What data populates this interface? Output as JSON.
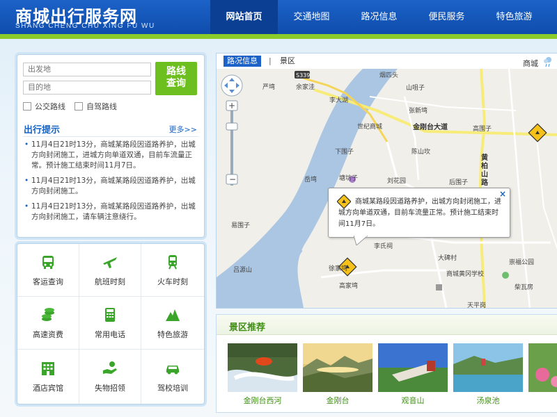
{
  "header": {
    "title": "商城出行服务网",
    "subtitle": "SHANG CHENG CHU XING FU WU",
    "nav": [
      "网站首页",
      "交通地图",
      "路况信息",
      "便民服务",
      "特色旅游"
    ],
    "active_nav": 0
  },
  "route": {
    "from_placeholder": "出发地",
    "to_placeholder": "目的地",
    "query_line1": "路线",
    "query_line2": "查询",
    "bus_label": "公交路线",
    "drive_label": "自驾路线"
  },
  "tips": {
    "title": "出行提示",
    "more": "更多>>",
    "items": [
      "11月4日21时13分，商城某路段因道路养护，出城方向封闭施工，进城方向单道双通，目前车流量正常。预计施工结束时间11月7日。",
      "11月4日21时13分，商城某路段因道路养护，出城方向封闭施工。",
      "11月4日21时13分，商城某路段因道路养护，出城方向封闭施工，请车辆注意绕行。"
    ]
  },
  "services": [
    {
      "label": "客运查询",
      "icon": "bus-icon"
    },
    {
      "label": "航班时刻",
      "icon": "airplane-icon"
    },
    {
      "label": "火车时刻",
      "icon": "train-icon"
    },
    {
      "label": "高速资费",
      "icon": "coins-icon"
    },
    {
      "label": "常用电话",
      "icon": "phone-icon"
    },
    {
      "label": "特色旅游",
      "icon": "mountain-icon"
    },
    {
      "label": "酒店宾馆",
      "icon": "hotel-icon"
    },
    {
      "label": "失物招领",
      "icon": "hand-icon"
    },
    {
      "label": "驾校培训",
      "icon": "car-icon"
    }
  ],
  "map": {
    "tab_active": "路况信息",
    "tab_other": "景区",
    "tab_separator": "|",
    "city": "商城",
    "labels": {
      "s339": "S339",
      "yanxitou": "烟匹头",
      "yanwan": "严塆",
      "yujiawa": "余家洼",
      "shanjuzi": "山咀子",
      "lidahu": "李大湖",
      "zhangxinwan": "张新塆",
      "shijishangcheng": "世纪商城",
      "jingangtai": "金刚台大道",
      "gaoweizi": "高围子",
      "xiaweizi": "下围子",
      "chenshankan": "陈山坎",
      "huangbailu": "黄柏山路",
      "yuewan": "岳塆",
      "tangfangzi": "塘坊子",
      "liuhuayuan": "刘花园",
      "houweizi": "后围子",
      "yiweizi": "易围子",
      "lishici": "李氏祠",
      "dabeicun": "大碑村",
      "chongfugongyuan": "崇福公园",
      "lvyuanshan": "吕源山",
      "xujiawan": "徐家塆",
      "xuexiao": "商城黄冈学校",
      "gaojiawan": "高家塆",
      "chaiwafang": "柴瓦房",
      "tianpinggang": "天平岗"
    },
    "popup_text": "商城某路段因道路养护，出城方向封闭施工，进城方向单道双通，目前车流量正常。预计施工结束时间11月7日。",
    "popup_close": "×"
  },
  "scenic": {
    "title": "景区推荐",
    "items": [
      "金刚台西河",
      "金刚台",
      "观音山",
      "汤泉池"
    ]
  },
  "colors": {
    "header_blue": "#1c62c8",
    "accent_green": "#6cbf1e",
    "link_blue": "#1663c3",
    "scenic_green": "#3f8f13"
  }
}
